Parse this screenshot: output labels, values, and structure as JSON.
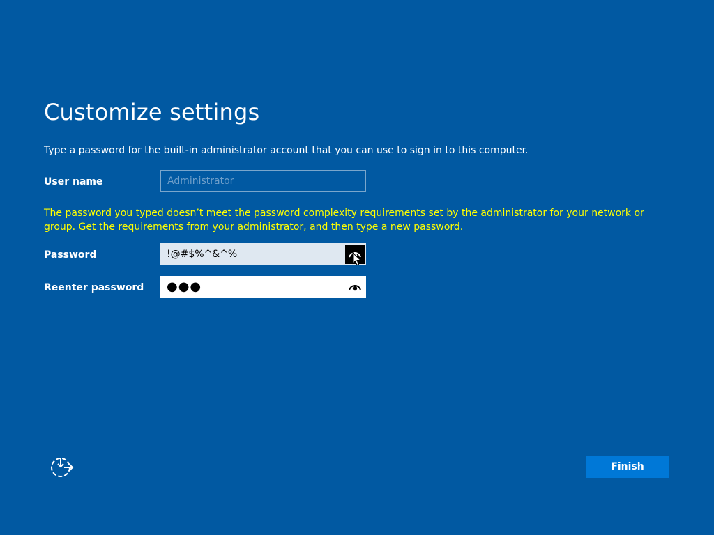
{
  "page": {
    "title": "Customize settings",
    "instruction": "Type a password for the built-in administrator account that you can use to sign in to this computer.",
    "error_message": "The password you typed doesn’t meet the password complexity requirements set by the administrator for your network or group. Get the requirements from your administrator, and then type a new password."
  },
  "form": {
    "username": {
      "label": "User name",
      "value": "Administrator"
    },
    "password": {
      "label": "Password",
      "value": "!@#$%^&^%"
    },
    "reenter_password": {
      "label": "Reenter password",
      "masked_value": "●●●"
    }
  },
  "footer": {
    "finish_label": "Finish"
  },
  "colors": {
    "background": "#0159a2",
    "error_text": "#ffff00",
    "finish_button": "#0078d7"
  }
}
